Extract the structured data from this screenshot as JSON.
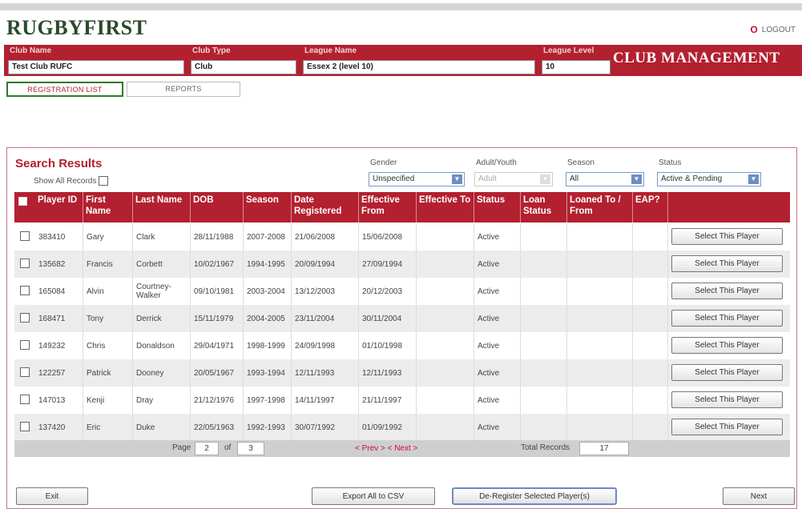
{
  "brand": {
    "logo": "RUGBYFIRST",
    "logout": "LOGOUT"
  },
  "club_bar": {
    "club_name_label": "Club Name",
    "club_name": "Test Club RUFC",
    "club_type_label": "Club Type",
    "club_type": "Club",
    "league_name_label": "League Name",
    "league_name": "Essex 2 (level 10)",
    "league_level_label": "League Level",
    "league_level": "10",
    "section_title": "CLUB MANAGEMENT"
  },
  "tabs": [
    {
      "label": "REGISTRATION LIST",
      "active": true
    },
    {
      "label": "REPORTS",
      "active": false
    }
  ],
  "search": {
    "title": "Search Results",
    "show_all_label": "Show All Records",
    "filters": {
      "gender_label": "Gender",
      "gender": "Unspecified",
      "adult_youth_label": "Adult/Youth",
      "adult_youth": "Adult",
      "season_label": "Season",
      "season": "All",
      "status_label": "Status",
      "status": "Active & Pending"
    }
  },
  "table": {
    "headers": [
      "Player ID",
      "First Name",
      "Last Name",
      "DOB",
      "Season",
      "Date Registered",
      "Effective From",
      "Effective To",
      "Status",
      "Loan Status",
      "Loaned To / From",
      "EAP?"
    ],
    "select_label": "Select This Player",
    "rows": [
      {
        "id": "383410",
        "first": "Gary",
        "last": "Clark",
        "dob": "28/11/1988",
        "season": "2007-2008",
        "registered": "21/06/2008",
        "from": "15/06/2008",
        "to": "",
        "status": "Active",
        "loan": "",
        "loaned": "",
        "eap": ""
      },
      {
        "id": "135682",
        "first": "Francis",
        "last": "Corbett",
        "dob": "10/02/1967",
        "season": "1994-1995",
        "registered": "20/09/1994",
        "from": "27/09/1994",
        "to": "",
        "status": "Active",
        "loan": "",
        "loaned": "",
        "eap": ""
      },
      {
        "id": "165084",
        "first": "Alvin",
        "last": "Courtney-Walker",
        "dob": "09/10/1981",
        "season": "2003-2004",
        "registered": "13/12/2003",
        "from": "20/12/2003",
        "to": "",
        "status": "Active",
        "loan": "",
        "loaned": "",
        "eap": ""
      },
      {
        "id": "168471",
        "first": "Tony",
        "last": "Derrick",
        "dob": "15/11/1979",
        "season": "2004-2005",
        "registered": "23/11/2004",
        "from": "30/11/2004",
        "to": "",
        "status": "Active",
        "loan": "",
        "loaned": "",
        "eap": ""
      },
      {
        "id": "149232",
        "first": "Chris",
        "last": "Donaldson",
        "dob": "29/04/1971",
        "season": "1998-1999",
        "registered": "24/09/1998",
        "from": "01/10/1998",
        "to": "",
        "status": "Active",
        "loan": "",
        "loaned": "",
        "eap": ""
      },
      {
        "id": "122257",
        "first": "Patrick",
        "last": "Dooney",
        "dob": "20/05/1967",
        "season": "1993-1994",
        "registered": "12/11/1993",
        "from": "12/11/1993",
        "to": "",
        "status": "Active",
        "loan": "",
        "loaned": "",
        "eap": ""
      },
      {
        "id": "147013",
        "first": "Kenji",
        "last": "Dray",
        "dob": "21/12/1976",
        "season": "1997-1998",
        "registered": "14/11/1997",
        "from": "21/11/1997",
        "to": "",
        "status": "Active",
        "loan": "",
        "loaned": "",
        "eap": ""
      },
      {
        "id": "137420",
        "first": "Eric",
        "last": "Duke",
        "dob": "22/05/1963",
        "season": "1992-1993",
        "registered": "30/07/1992",
        "from": "01/09/1992",
        "to": "",
        "status": "Active",
        "loan": "",
        "loaned": "",
        "eap": ""
      }
    ]
  },
  "pager": {
    "page_label": "Page",
    "page": "2",
    "of_label": "of",
    "total_pages": "3",
    "prev_next": "< Prev > < Next >",
    "total_label": "Total Records",
    "total": "17"
  },
  "actions": {
    "exit": "Exit",
    "export": "Export All to CSV",
    "deregister": "De-Register Selected Player(s)",
    "next": "Next"
  },
  "colors": {
    "brand_red": "#b3202f",
    "logo_green": "#2b4a2b",
    "tab_active_border": "#2d7a2d"
  }
}
